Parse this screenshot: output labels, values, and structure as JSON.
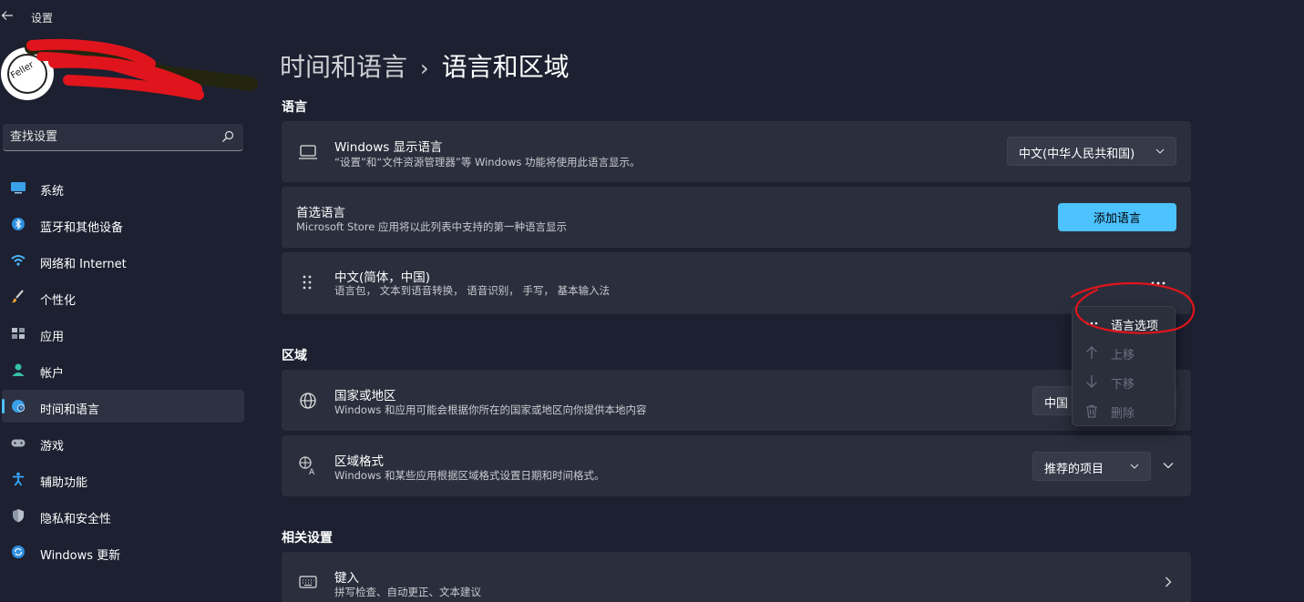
{
  "window": {
    "title": "设置"
  },
  "avatar": {
    "text": "Feller"
  },
  "search": {
    "placeholder": "查找设置"
  },
  "nav": {
    "items": [
      {
        "label": "系统",
        "icon": "monitor-icon"
      },
      {
        "label": "蓝牙和其他设备",
        "icon": "bluetooth-icon"
      },
      {
        "label": "网络和 Internet",
        "icon": "wifi-icon"
      },
      {
        "label": "个性化",
        "icon": "brush-icon"
      },
      {
        "label": "应用",
        "icon": "apps-icon"
      },
      {
        "label": "帐户",
        "icon": "person-icon"
      },
      {
        "label": "时间和语言",
        "icon": "globe-clock-icon",
        "active": true
      },
      {
        "label": "游戏",
        "icon": "gamepad-icon"
      },
      {
        "label": "辅助功能",
        "icon": "accessibility-icon"
      },
      {
        "label": "隐私和安全性",
        "icon": "shield-icon"
      },
      {
        "label": "Windows 更新",
        "icon": "update-icon"
      }
    ]
  },
  "breadcrumb": {
    "parent": "时间和语言",
    "separator": "›",
    "current": "语言和区域"
  },
  "language_section": {
    "title": "语言",
    "display_language": {
      "title": "Windows 显示语言",
      "desc": "“设置”和“文件资源管理器”等 Windows 功能将使用此语言显示。",
      "value": "中文(中华人民共和国)"
    },
    "preferred": {
      "title": "首选语言",
      "desc": "Microsoft Store 应用将以此列表中支持的第一种语言显示",
      "add_button": "添加语言"
    },
    "installed": {
      "title": "中文(简体，中国)",
      "desc": "语言包， 文本到语音转换， 语音识别， 手写， 基本输入法"
    }
  },
  "context_menu": {
    "items": [
      {
        "label": "语言选项",
        "icon": "more-icon",
        "enabled": true
      },
      {
        "label": "上移",
        "icon": "arrow-up-icon",
        "enabled": false
      },
      {
        "label": "下移",
        "icon": "arrow-down-icon",
        "enabled": false
      },
      {
        "label": "删除",
        "icon": "trash-icon",
        "enabled": false
      }
    ]
  },
  "region_section": {
    "title": "区域",
    "country": {
      "title": "国家或地区",
      "desc": "Windows 和应用可能会根据你所在的国家或地区向你提供本地内容",
      "value": "中国"
    },
    "format": {
      "title": "区域格式",
      "desc": "Windows 和某些应用根据区域格式设置日期和时间格式。",
      "value": "推荐的项目"
    }
  },
  "related_section": {
    "title": "相关设置",
    "typing": {
      "title": "键入",
      "desc": "拼写检查、自动更正、文本建议"
    }
  },
  "colors": {
    "accent": "#4cc2ff",
    "background": "#1c2030",
    "card": "#2b2f3d",
    "annotation": "#e0141c"
  }
}
